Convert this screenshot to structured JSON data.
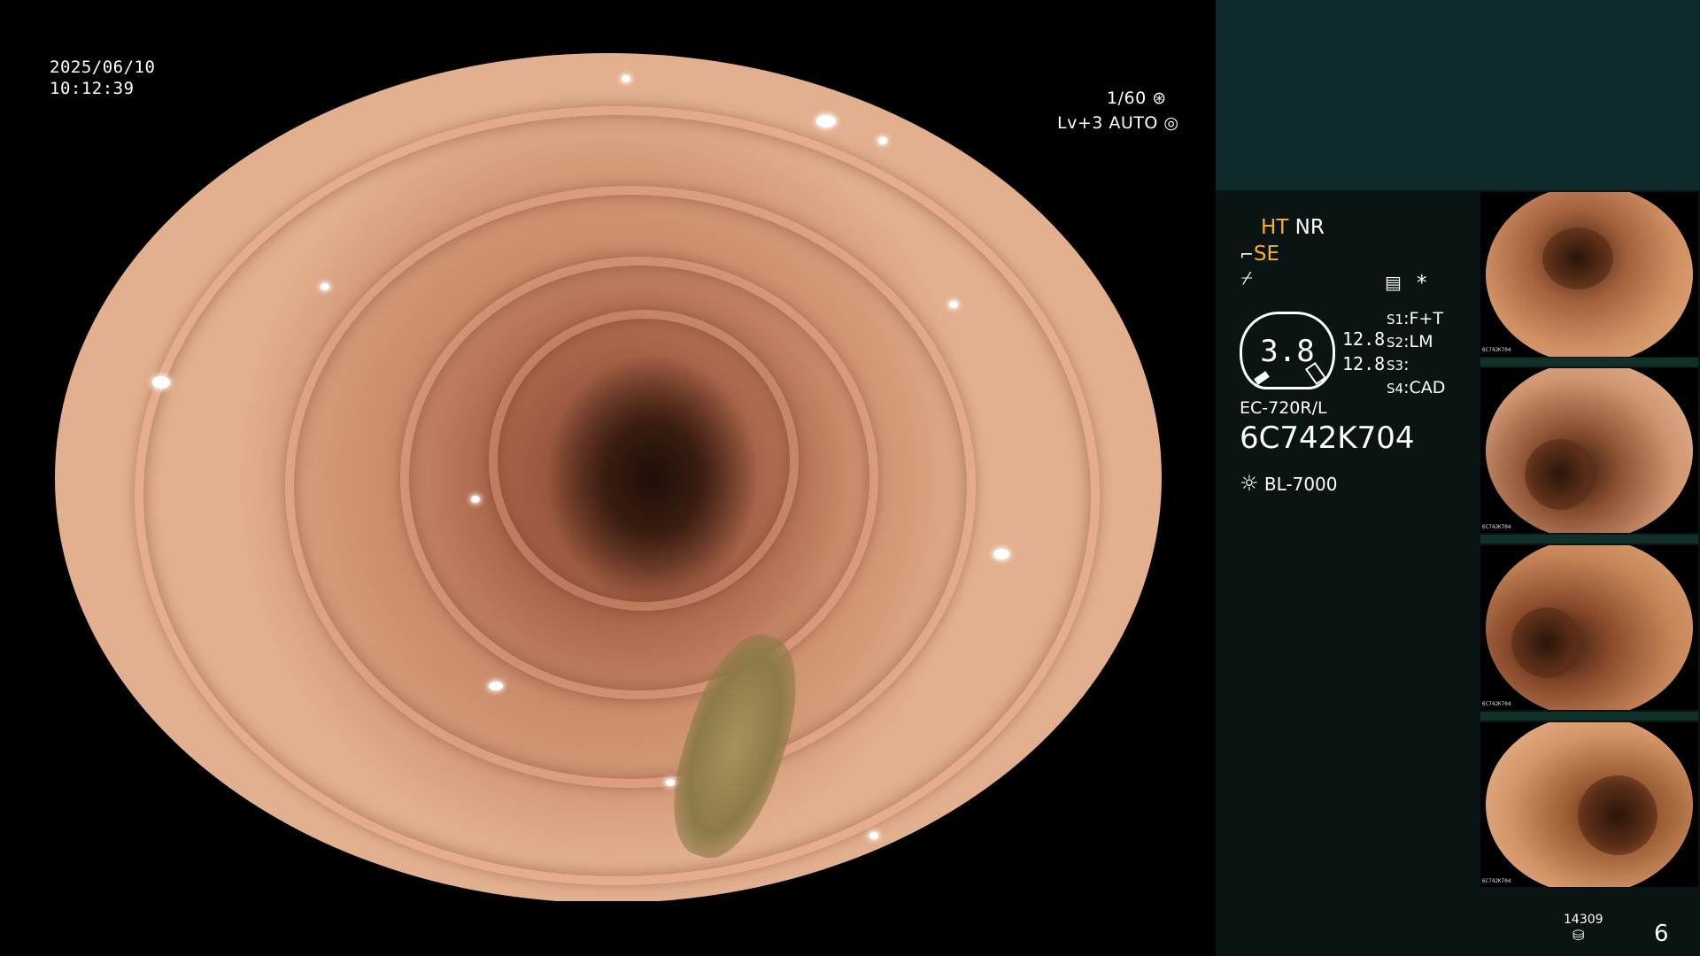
{
  "overlay": {
    "date": "2025/06/10",
    "time": "10:12:39",
    "shutter": "1/60",
    "shutter_icon": "shutter-icon",
    "level": "Lv+3",
    "mode": "AUTO",
    "mode_icon": "iris-icon"
  },
  "panel": {
    "ht": "HT",
    "nr": "NR",
    "se": "SE",
    "structure_icon": "structure-icon",
    "edge_icon": "edge-icon",
    "menu_icon": "settings-grid-icon",
    "asterisk": "*",
    "gauge_value": "3.8",
    "readout_1": "12.8",
    "readout_2": "12.8",
    "switches": [
      {
        "key": "S1",
        "value": "F+T"
      },
      {
        "key": "S2",
        "value": "LM"
      },
      {
        "key": "S3",
        "value": ""
      },
      {
        "key": "S4",
        "value": "CAD"
      }
    ],
    "scope_model": "EC-720R/L",
    "serial": "6C742K704",
    "light_icon": "light-source-icon",
    "light_source": "BL-7000",
    "storage_count": "14309",
    "storage_icon": "storage-icon",
    "image_count": "6"
  },
  "thumbnails": [
    {
      "label": "6C742K704"
    },
    {
      "label": "6C742K704"
    },
    {
      "label": "6C742K704"
    },
    {
      "label": "6C742K704"
    }
  ],
  "colors": {
    "accent_orange": "#ffae2b",
    "panel_bg": "#0a1414",
    "panel_top_bg": "#0e2a2a"
  }
}
